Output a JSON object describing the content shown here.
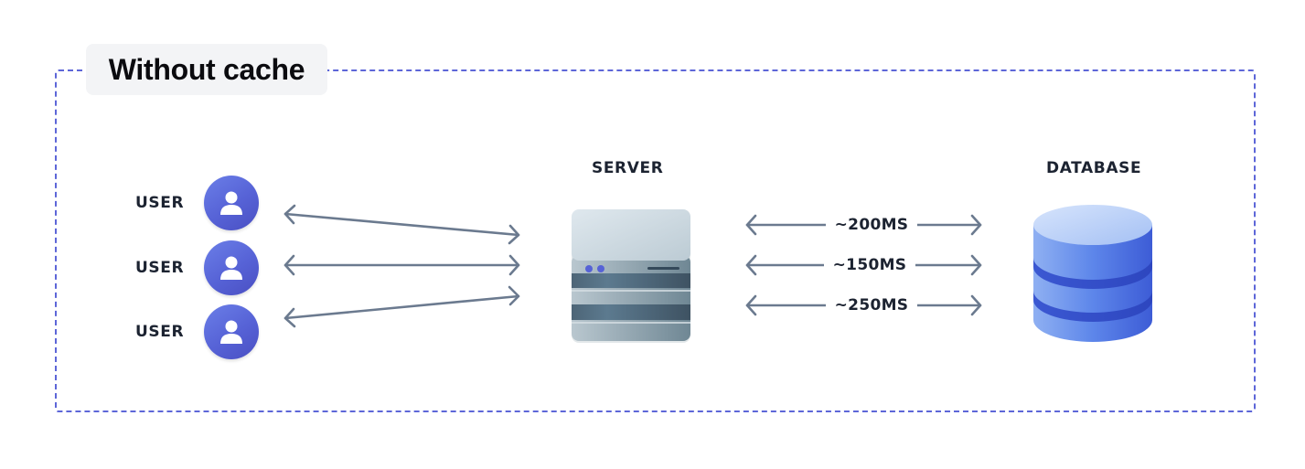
{
  "title": "Without cache",
  "users": [
    {
      "label": "USER",
      "icon": "user-icon"
    },
    {
      "label": "USER",
      "icon": "user-icon"
    },
    {
      "label": "USER",
      "icon": "user-icon"
    }
  ],
  "server": {
    "label": "SERVER",
    "icon": "server-icon"
  },
  "database": {
    "label": "DATABASE",
    "icon": "database-icon"
  },
  "latencies": [
    "~200MS",
    "~150MS",
    "~250MS"
  ],
  "colors": {
    "frame_border": "#5d66d8",
    "arrow": "#6b7a8f",
    "avatar": "#5662d6",
    "database": "#4a6fe0",
    "server": "#7f98a6",
    "text": "#1c2331"
  }
}
